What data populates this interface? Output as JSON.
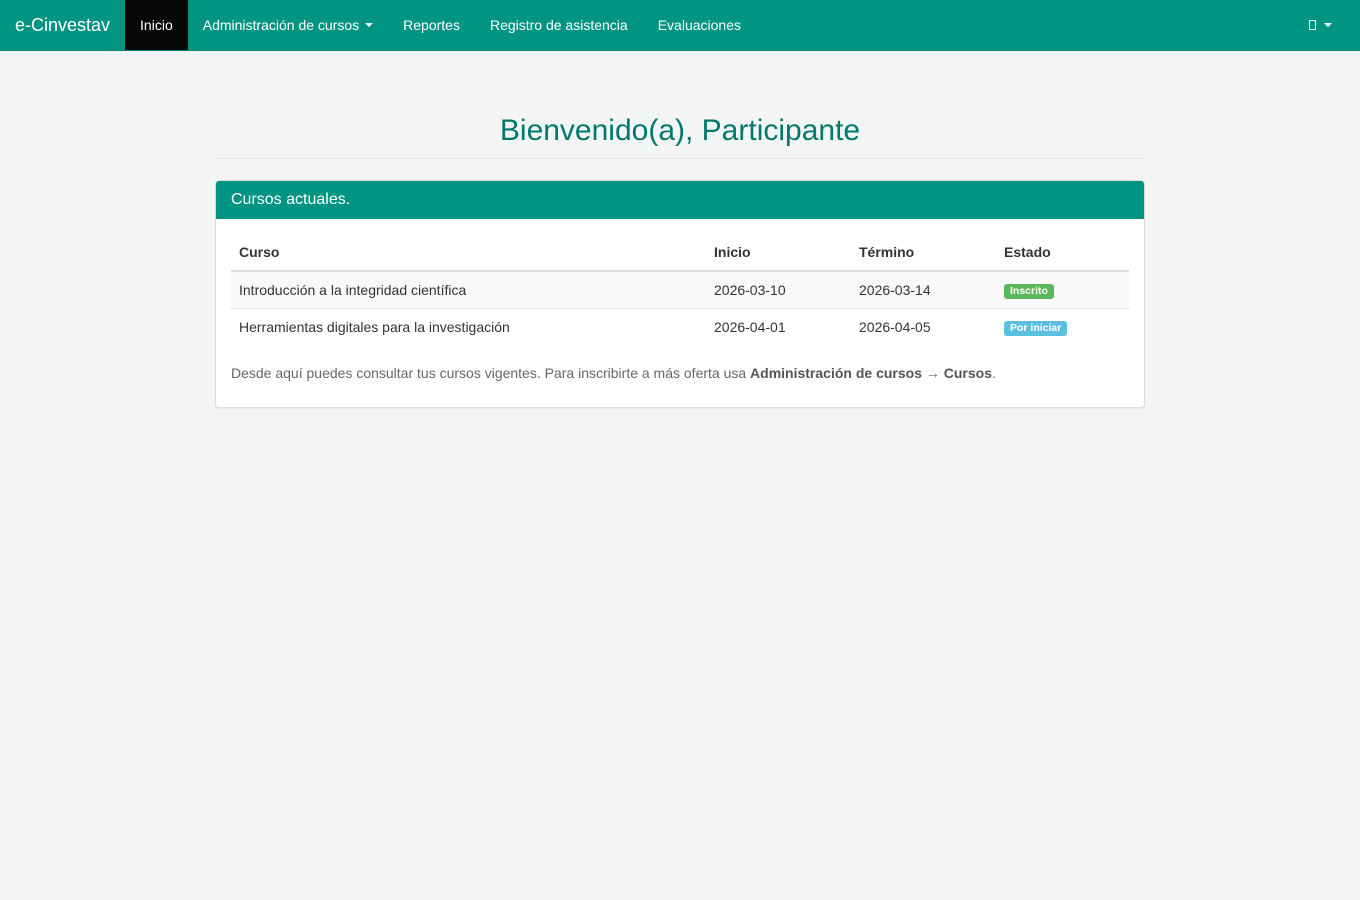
{
  "navbar": {
    "brand": "e-Cinvestav",
    "items": [
      {
        "label": "Inicio",
        "active": true
      },
      {
        "label": "Administración de cursos",
        "dropdown": true
      },
      {
        "label": "Reportes"
      },
      {
        "label": "Registro de asistencia"
      },
      {
        "label": "Evaluaciones"
      }
    ],
    "user_menu_icon": "user-icon",
    "accent_color": "#009483",
    "active_color": "#080808"
  },
  "page": {
    "title": "Bienvenido(a), Participante"
  },
  "panel": {
    "heading": "Cursos actuales.",
    "table": {
      "headers": [
        "Curso",
        "Inicio",
        "Término",
        "Estado"
      ],
      "rows": [
        {
          "curso": "Introducción a la integridad científica",
          "inicio": "2026-03-10",
          "termino": "2026-03-14",
          "estado": "Inscrito",
          "estado_color": "#5cb85c"
        },
        {
          "curso": "Herramientas digitales para la investigación",
          "inicio": "2026-04-01",
          "termino": "2026-04-05",
          "estado": "Por iniciar",
          "estado_color": "#5bc0de"
        }
      ]
    },
    "help": {
      "prefix": "Desde aquí puedes consultar tus cursos vigentes. Para inscribirte a más oferta usa ",
      "menu": "Administración de cursos",
      "arrow": " → ",
      "item": "Cursos",
      "suffix": "."
    }
  }
}
